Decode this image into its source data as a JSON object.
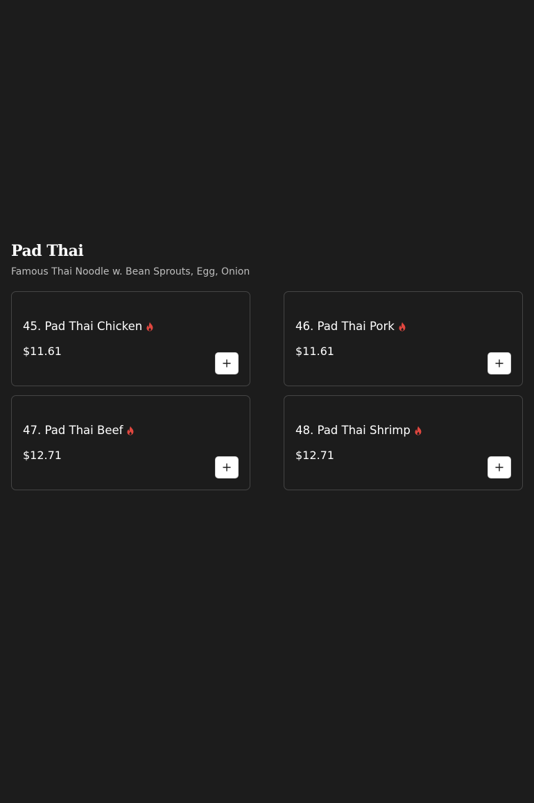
{
  "section": {
    "title": "Pad Thai",
    "subtitle": "Famous Thai Noodle w. Bean Sprouts, Egg, Onion"
  },
  "items": [
    {
      "name": "45. Pad Thai Chicken",
      "price": "$11.61",
      "spicy_icon": "flame-icon",
      "add_icon": "plus-icon"
    },
    {
      "name": "46. Pad Thai Pork",
      "price": "$11.61",
      "spicy_icon": "flame-icon",
      "add_icon": "plus-icon"
    },
    {
      "name": "47. Pad Thai Beef",
      "price": "$12.71",
      "spicy_icon": "flame-icon",
      "add_icon": "plus-icon"
    },
    {
      "name": "48. Pad Thai Shrimp",
      "price": "$12.71",
      "spicy_icon": "flame-icon",
      "add_icon": "plus-icon"
    }
  ],
  "colors": {
    "background": "#1c1c1c",
    "card_border": "#454545",
    "text": "#ffffff",
    "subtitle": "#bdbdbd",
    "spicy": "#e0473f",
    "button_bg": "#ffffff"
  }
}
